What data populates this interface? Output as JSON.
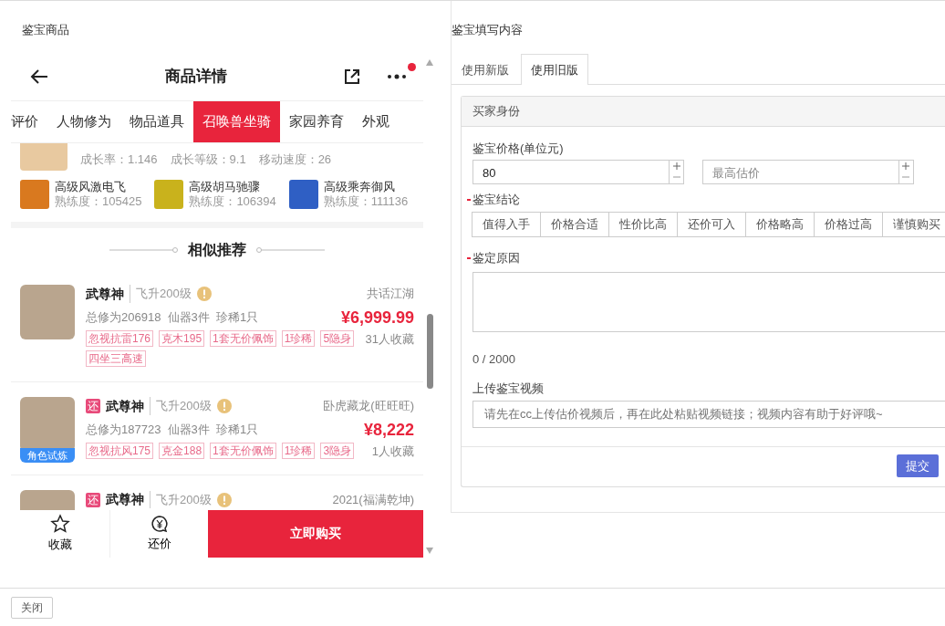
{
  "left_panel": {
    "title": "鉴宝商品",
    "phone": {
      "title": "商品详情",
      "notification_dot": true,
      "tabs": [
        {
          "label": "评价",
          "selected": false
        },
        {
          "label": "人物修为",
          "selected": false
        },
        {
          "label": "物品道具",
          "selected": false
        },
        {
          "label": "召唤兽坐骑",
          "selected": true
        },
        {
          "label": "家园养育",
          "selected": false
        },
        {
          "label": "外观",
          "selected": false
        }
      ],
      "mount_stats": [
        "成长率：1.146",
        "成长等级：9.1",
        "移动速度：26"
      ],
      "skills": [
        {
          "name": "高级风激电飞",
          "proficiency": "熟练度：105425",
          "color": "#d9791f"
        },
        {
          "name": "高级胡马驰骤",
          "proficiency": "熟练度：106394",
          "color": "#c9b21c"
        },
        {
          "name": "高级乘奔御风",
          "proficiency": "熟练度：111136",
          "color": "#2f5fc4"
        }
      ],
      "section_title": "相似推荐",
      "listings": [
        {
          "name": "武尊神",
          "level": "飞升200级",
          "server": "共话江湖",
          "summary": "总修为206918  仙器3件  珍稀1只",
          "price": "¥6,999.99",
          "favorites": "31人收藏",
          "tags": [
            "忽视抗雷176",
            "克木195",
            "1套无价佩饰",
            "1珍稀",
            "5隐身",
            "四坐三高速"
          ]
        },
        {
          "bargain_badge": "还",
          "name": "武尊神",
          "level": "飞升200级",
          "server": "卧虎藏龙(旺旺旺)",
          "summary": "总修为187723  仙器3件  珍稀1只",
          "price": "¥8,222",
          "favorites": "1人收藏",
          "avatar_badge": "角色试炼",
          "tags": [
            "忽视抗风175",
            "克金188",
            "1套无价佩饰",
            "1珍稀",
            "3隐身"
          ]
        },
        {
          "bargain_badge": "还",
          "name": "武尊神",
          "level": "飞升200级",
          "server": "2021(福满乾坤)"
        }
      ],
      "bottom_bar": {
        "favorite": "收藏",
        "bargain": "还价",
        "buy": "立即购买"
      }
    }
  },
  "right_panel": {
    "title": "鉴宝填写内容",
    "tabs": [
      {
        "label": "使用新版",
        "selected": false
      },
      {
        "label": "使用旧版",
        "selected": true
      }
    ],
    "section": "买家身份",
    "price_label": "鉴宝价格(单位元)",
    "price_value": "80",
    "max_price_placeholder": "最高估价",
    "conclusion_label": "鉴宝结论",
    "conclusion_required": true,
    "conclusions": [
      {
        "label": "值得入手",
        "selected": false
      },
      {
        "label": "价格合适",
        "selected": false
      },
      {
        "label": "性价比高",
        "selected": false
      },
      {
        "label": "还价可入",
        "selected": false
      },
      {
        "label": "价格略高",
        "selected": false
      },
      {
        "label": "价格过高",
        "selected": false
      },
      {
        "label": "谨慎购买",
        "selected": false
      }
    ],
    "reason_label": "鉴定原因",
    "reason_required": true,
    "reason_counter": "0 / 2000",
    "video_label": "上传鉴宝视频",
    "video_placeholder": "请先在cc上传估价视频后，再在此处粘贴视频链接；视频内容有助于好评哦~",
    "submit": "提交"
  },
  "footer": {
    "close": "关闭"
  }
}
